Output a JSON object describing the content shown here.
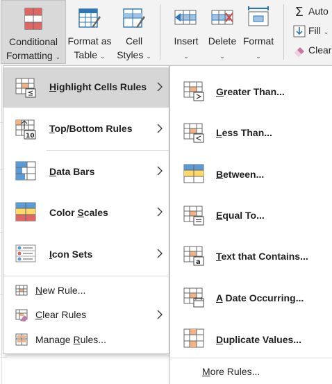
{
  "ribbon": {
    "conditional_formatting": {
      "line1": "Conditional",
      "line2": "Formatting"
    },
    "format_as_table": {
      "line1": "Format as",
      "line2": "Table"
    },
    "cell_styles": {
      "line1": "Cell",
      "line2": "Styles"
    },
    "insert": {
      "label": "Insert"
    },
    "delete": {
      "label": "Delete"
    },
    "format": {
      "label": "Format"
    },
    "autosum": {
      "label": "Auto"
    },
    "fill": {
      "label": "Fill"
    },
    "clear": {
      "label": "Clear"
    },
    "caret": "⌄"
  },
  "menu1": {
    "items": [
      {
        "pre": "",
        "u": "H",
        "post": "ighlight Cells Rules",
        "icon": "highlight-cells-icon"
      },
      {
        "pre": "",
        "u": "T",
        "post": "op/Bottom Rules",
        "icon": "top-bottom-icon"
      },
      {
        "pre": "",
        "u": "D",
        "post": "ata Bars",
        "icon": "data-bars-icon"
      },
      {
        "pre": "Color ",
        "u": "S",
        "post": "cales",
        "icon": "color-scales-icon"
      },
      {
        "pre": "",
        "u": "I",
        "post": "con Sets",
        "icon": "icon-sets-icon"
      }
    ],
    "small_items": [
      {
        "pre": "",
        "u": "N",
        "post": "ew Rule...",
        "icon": "new-rule-icon"
      },
      {
        "pre": "",
        "u": "C",
        "post": "lear Rules",
        "icon": "clear-rules-icon"
      },
      {
        "pre": "Manage ",
        "u": "R",
        "post": "ules...",
        "icon": "manage-rules-icon"
      }
    ]
  },
  "menu2": {
    "items": [
      {
        "pre": "",
        "u": "G",
        "post": "reater Than...",
        "icon": "greater-than-icon"
      },
      {
        "pre": "",
        "u": "L",
        "post": "ess Than...",
        "icon": "less-than-icon"
      },
      {
        "pre": "",
        "u": "B",
        "post": "etween...",
        "icon": "between-icon"
      },
      {
        "pre": "",
        "u": "E",
        "post": "qual To...",
        "icon": "equal-to-icon"
      },
      {
        "pre": "",
        "u": "T",
        "post": "ext that Contains...",
        "icon": "text-contains-icon"
      },
      {
        "pre": "",
        "u": "A",
        "post": " Date Occurring...",
        "icon": "date-occurring-icon"
      },
      {
        "pre": "",
        "u": "D",
        "post": "uplicate Values...",
        "icon": "duplicate-values-icon"
      }
    ],
    "more": {
      "pre": "",
      "u": "M",
      "post": "ore Rules..."
    }
  },
  "colors": {
    "accent_blue": "#2e75b6",
    "highlight_orange": "#f4b183",
    "highlight_yellow": "#ffd966",
    "red": "#e06666",
    "menu_hover": "#d6d6d6"
  }
}
